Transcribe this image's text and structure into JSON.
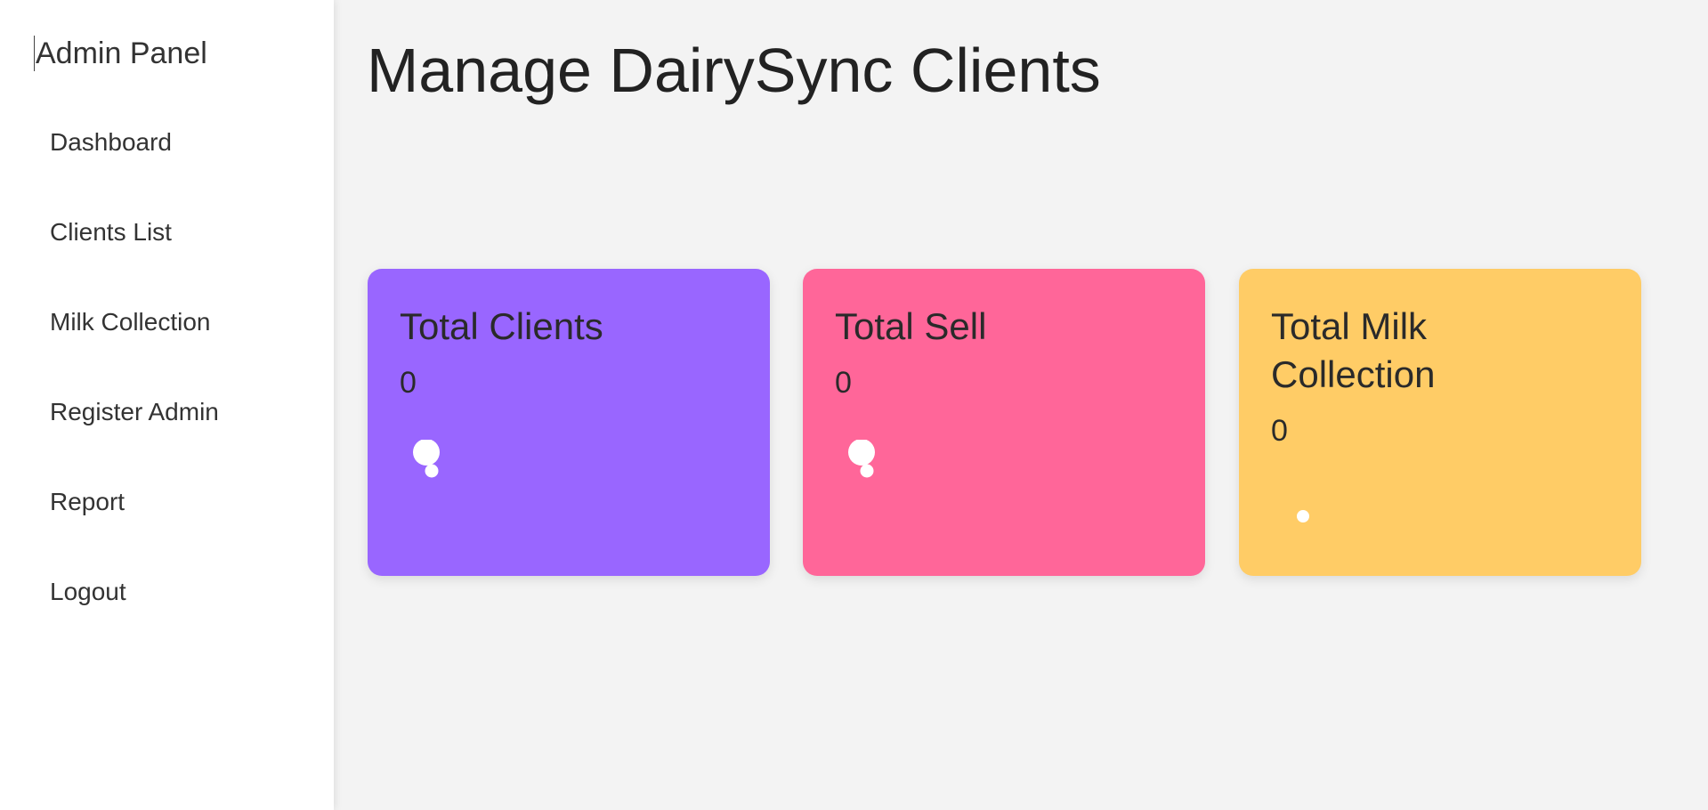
{
  "sidebar": {
    "title": "Admin Panel",
    "items": [
      {
        "label": "Dashboard"
      },
      {
        "label": "Clients List"
      },
      {
        "label": "Milk Collection"
      },
      {
        "label": "Register Admin"
      },
      {
        "label": "Report"
      },
      {
        "label": "Logout"
      }
    ]
  },
  "main": {
    "title": "Manage DairySync Clients",
    "cards": [
      {
        "title": "Total Clients",
        "value": "0",
        "color": "#9966ff",
        "icon": "bubble-icon"
      },
      {
        "title": "Total Sell",
        "value": "0",
        "color": "#ff6699",
        "icon": "bubble-icon"
      },
      {
        "title": "Total Milk Collection",
        "value": "0",
        "color": "#ffcc66",
        "icon": "dot-icon"
      }
    ]
  }
}
